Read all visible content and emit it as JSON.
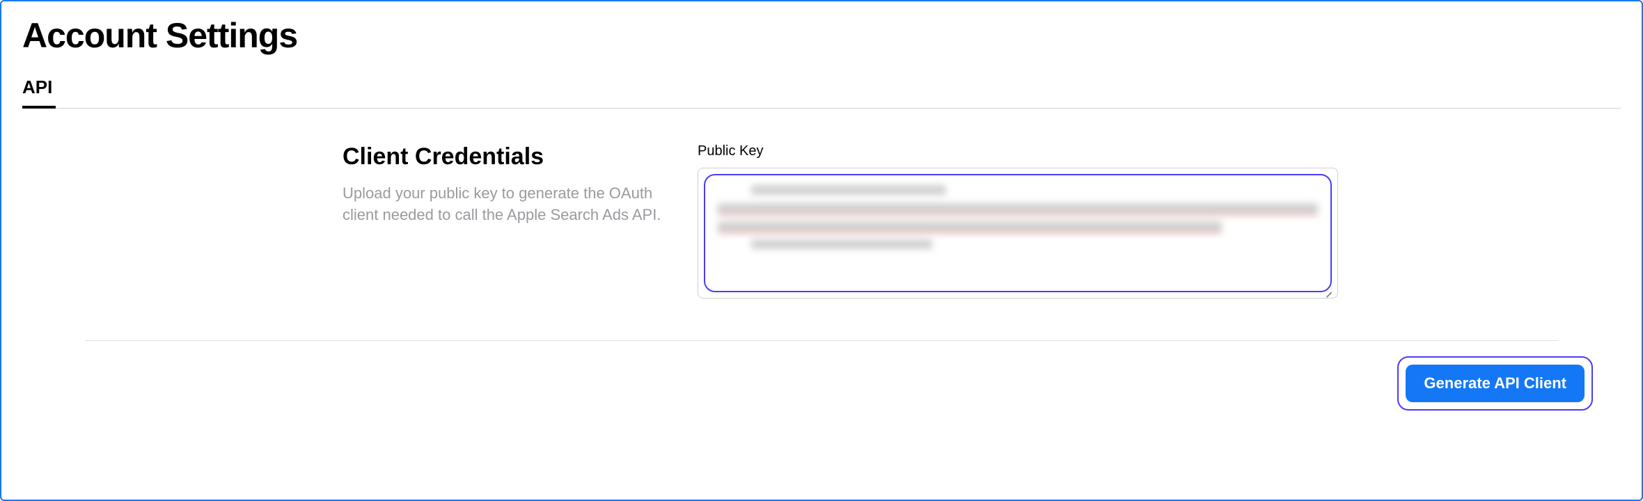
{
  "title": "Account Settings",
  "tabs": {
    "api": "API"
  },
  "section": {
    "heading": "Client Credentials",
    "description": "Upload your public key to generate the OAuth client needed to call the Apple Search Ads API."
  },
  "publicKey": {
    "label": "Public Key",
    "value": "-----BEGIN PUBLIC KEY-----\n(redacted)\n-----END PUBLIC KEY-----"
  },
  "actions": {
    "generate": "Generate API Client"
  }
}
